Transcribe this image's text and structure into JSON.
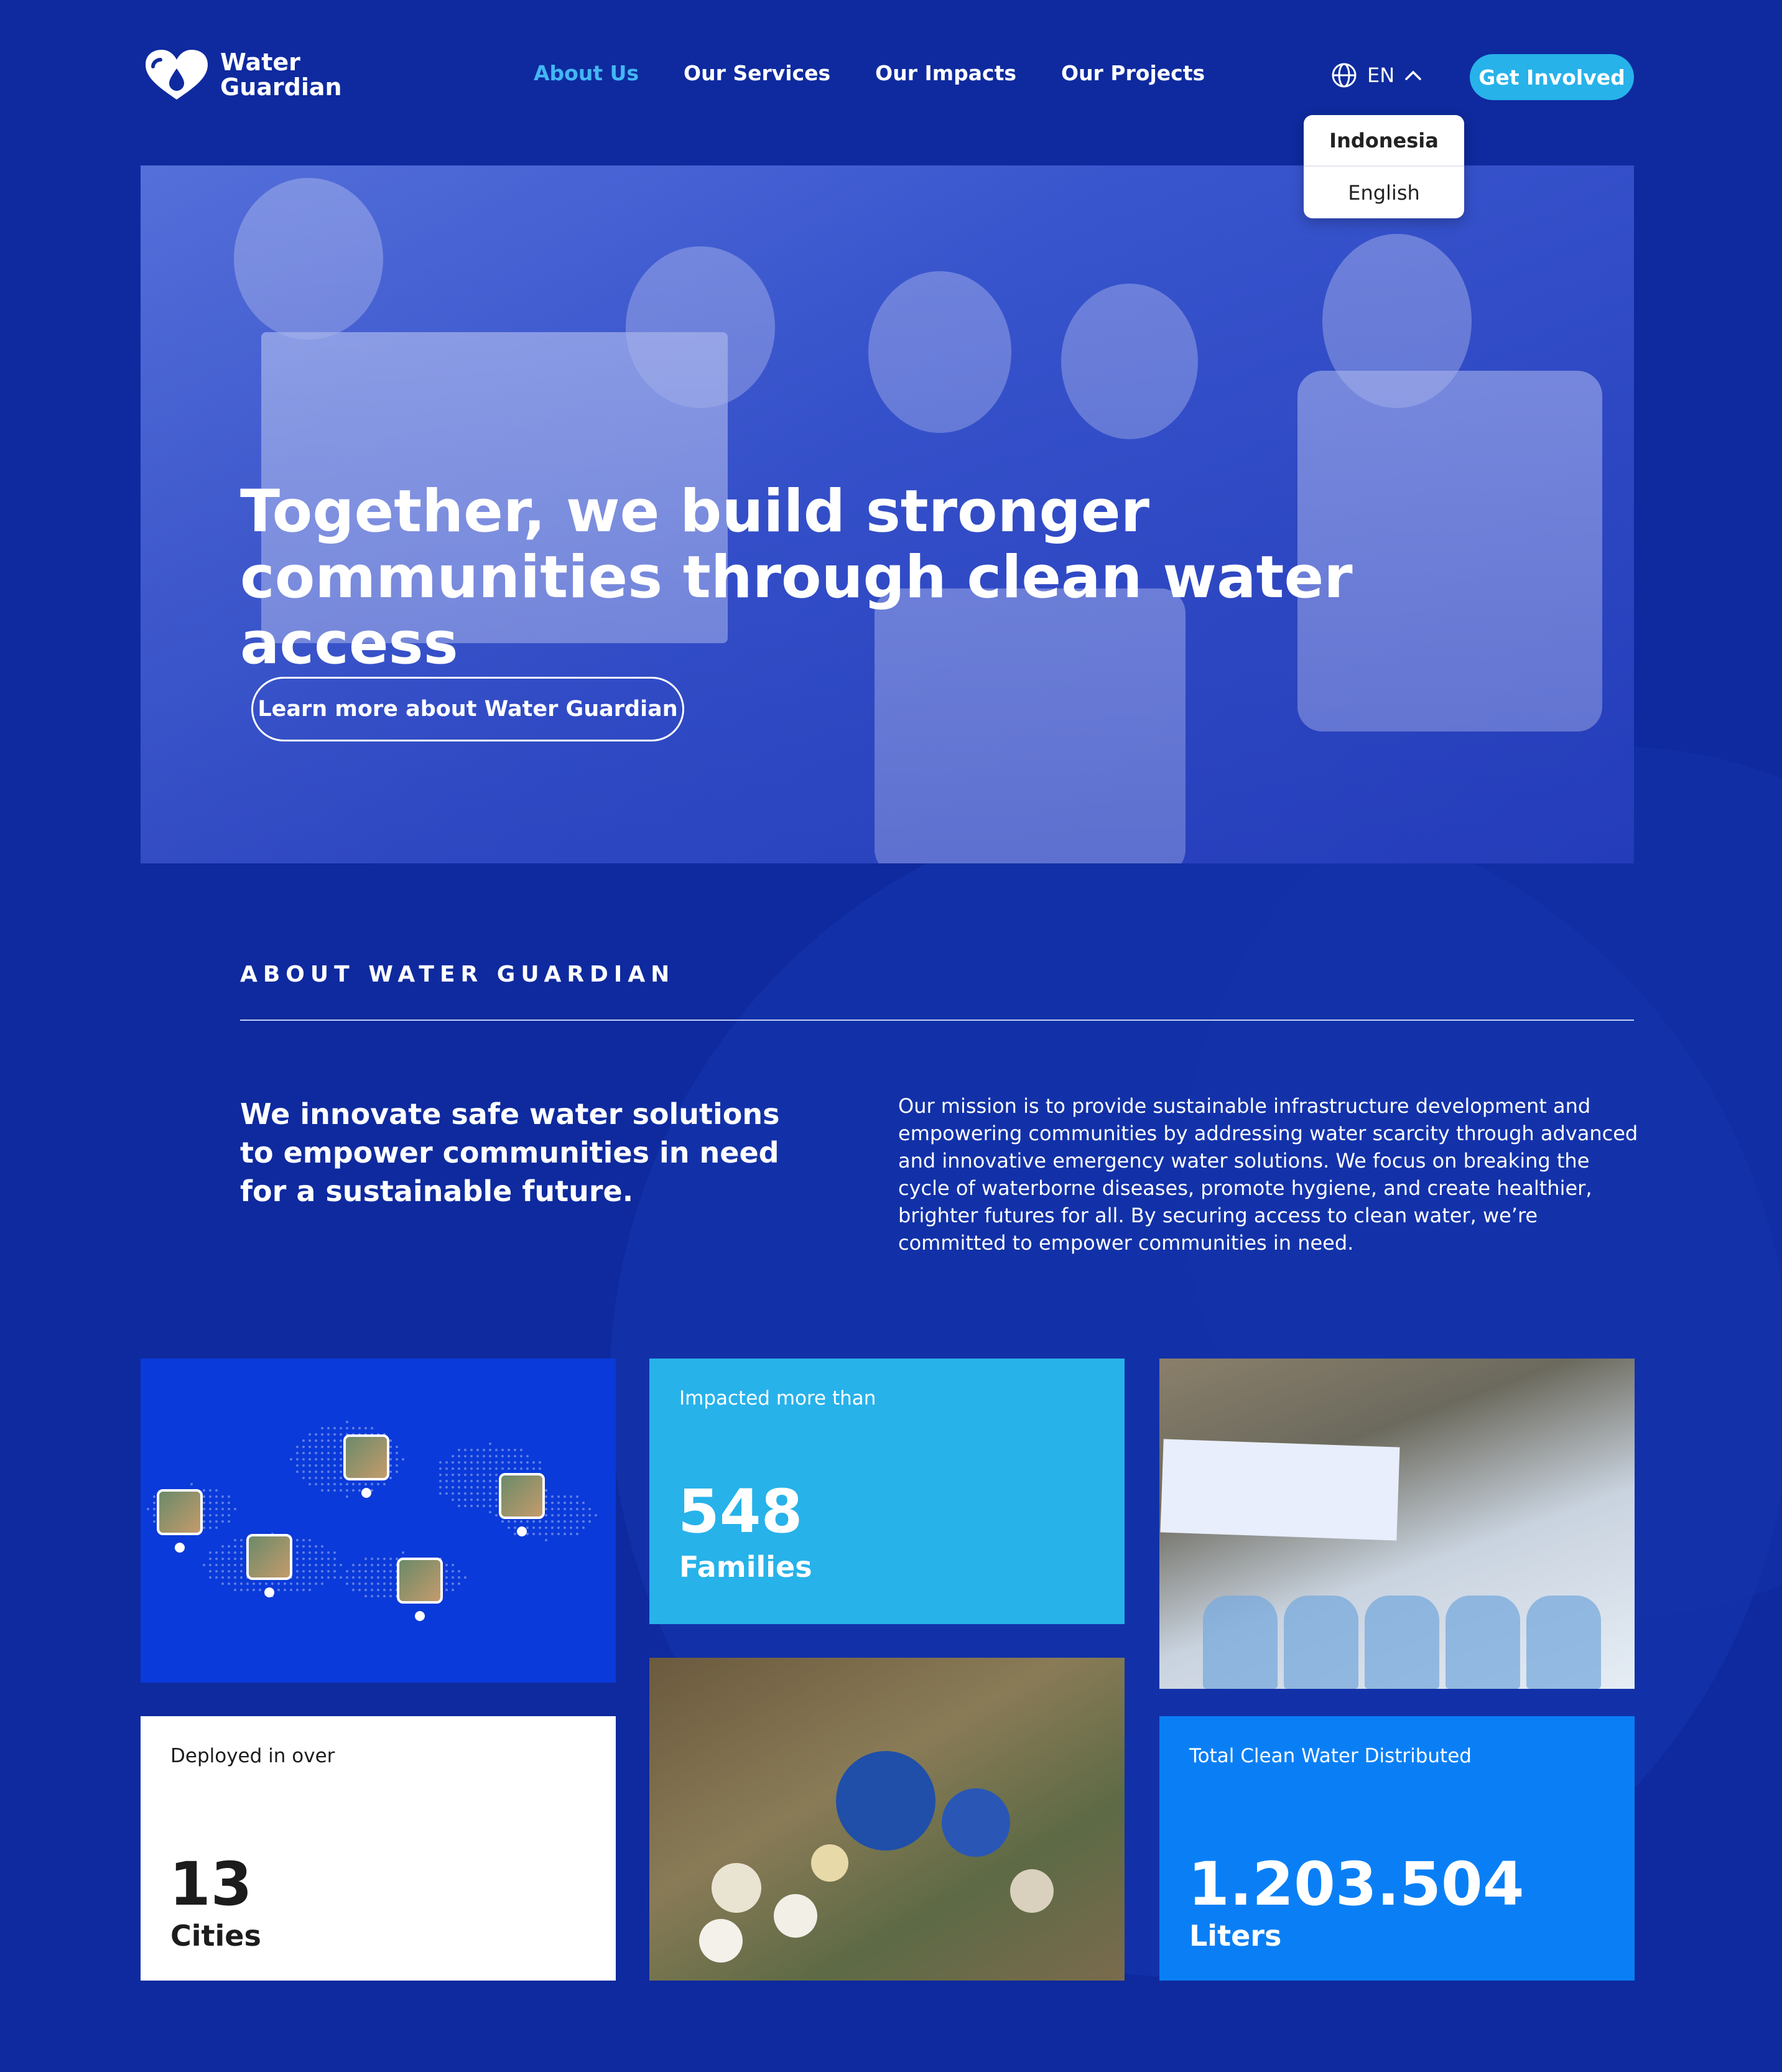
{
  "brand": {
    "line1": "Water",
    "line2": "Guardian",
    "logo": "heart-drop-logo"
  },
  "nav": {
    "items": [
      {
        "label": "About Us",
        "active": true
      },
      {
        "label": "Our Services",
        "active": false
      },
      {
        "label": "Our Impacts",
        "active": false
      },
      {
        "label": "Our Projects",
        "active": false
      }
    ]
  },
  "language": {
    "current": "EN",
    "icon": "globe-icon",
    "options": [
      "Indonesia",
      "English"
    ]
  },
  "cta": {
    "label": "Get Involved"
  },
  "hero": {
    "title": "Together, we build stronger communities through clean water access",
    "button": "Learn more about Water Guardian"
  },
  "about": {
    "label": "ABOUT WATER GUARDIAN",
    "lead": "We innovate safe water solutions to empower communities in need for a sustainable future.",
    "body": "Our mission is to provide sustainable infrastructure development and empowering communities by addressing water scarcity through advanced and innovative emergency water solutions. We focus on breaking the cycle of waterborne diseases, promote hygiene, and create healthier, brighter futures for all. By securing access to clean water, we’re committed to empower communities in need."
  },
  "stats": {
    "families": {
      "label": "Impacted more than",
      "value": "548",
      "unit": "Families"
    },
    "cities": {
      "label": "Deployed in over",
      "value": "13",
      "unit": "Cities"
    },
    "water": {
      "label": "Total Clean Water Distributed",
      "value": "1.203.504",
      "unit": "Liters"
    }
  },
  "colors": {
    "background": "#0e2a9e",
    "accent": "#27b2ea",
    "active_nav": "#43b6f3",
    "water_card": "#0a7ff5",
    "map_card": "#0a3ad9"
  }
}
